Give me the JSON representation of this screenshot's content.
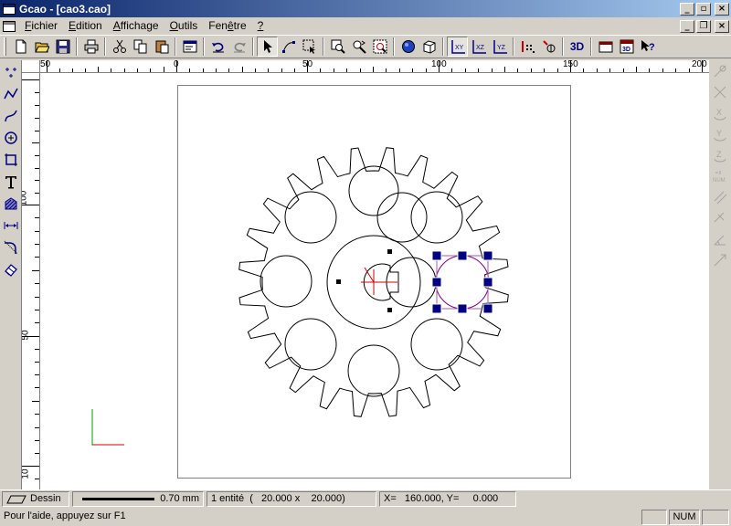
{
  "window": {
    "title": "Gcao - [cao3.cao]"
  },
  "menu": {
    "items": [
      {
        "u": "F",
        "rest": "ichier"
      },
      {
        "u": "E",
        "rest": "dition"
      },
      {
        "u": "A",
        "rest": "ffichage"
      },
      {
        "u": "O",
        "rest": "utils"
      },
      {
        "u": "",
        "pre": "Fen",
        "mid": "ê",
        "rest": "tre"
      },
      {
        "u": "?",
        "rest": ""
      }
    ]
  },
  "toolbar": {
    "btn_3d_label": "3D"
  },
  "rulers": {
    "h_labels": [
      "50",
      "0",
      "50",
      "100",
      "150",
      "200"
    ],
    "v_labels": [
      "100",
      "50",
      "10"
    ]
  },
  "status": {
    "layer": "Dessin",
    "line_width": "0.70 mm",
    "selection": "1 entité  (   20.000 x    20.000)",
    "coords": "X=   160.000, Y=     0.000",
    "help": "Pour l'aide, appuyez sur F1",
    "num": "NUM"
  }
}
